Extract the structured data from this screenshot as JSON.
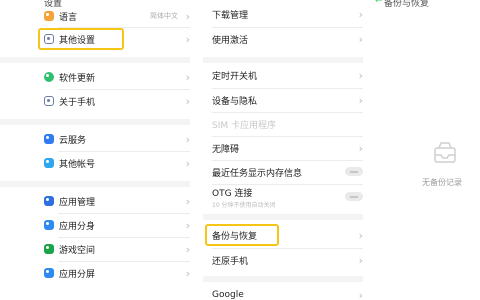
{
  "panel1": {
    "top_text": "设置",
    "items": [
      {
        "label": "语言",
        "value": "简体中文",
        "icon": "language-icon",
        "color": "#f2a33a"
      },
      {
        "label": "其他设置",
        "icon": "other-settings-icon",
        "color": "#6b7ca8"
      },
      {
        "label": "软件更新",
        "icon": "software-update-icon",
        "color": "#2fbf71"
      },
      {
        "label": "关于手机",
        "icon": "about-phone-icon",
        "color": "#6b7ca8"
      },
      {
        "label": "云服务",
        "icon": "cloud-service-icon",
        "color": "#2f7bf0"
      },
      {
        "label": "其他帐号",
        "icon": "other-accounts-icon",
        "color": "#2fa6f0"
      },
      {
        "label": "应用管理",
        "icon": "app-management-icon",
        "color": "#2f6fe0"
      },
      {
        "label": "应用分身",
        "icon": "app-clone-icon",
        "color": "#2f8af0"
      },
      {
        "label": "游戏空间",
        "icon": "game-space-icon",
        "color": "#1aa44a"
      },
      {
        "label": "应用分屏",
        "icon": "split-screen-icon",
        "color": "#2f8af0"
      }
    ]
  },
  "panel2": {
    "top_text": "下载管理",
    "items": [
      {
        "label": "下载管理"
      },
      {
        "label": "使用激活"
      },
      {
        "label": "定时开关机"
      },
      {
        "label": "设备与隐私"
      },
      {
        "label": "SIM 卡应用程序"
      },
      {
        "label": "无障碍"
      },
      {
        "label": "最近任务显示内存信息"
      },
      {
        "label": "OTG 连接"
      },
      {
        "label": "备份与恢复"
      },
      {
        "label": "还原手机"
      },
      {
        "label": "Google"
      }
    ],
    "otg_note": "10 分钟不使用自动关闭"
  },
  "panel3": {
    "back": "←",
    "title": "备份与恢复",
    "empty_text": "无备份记录"
  },
  "colors": {
    "highlight": "#f5c518",
    "accent_green": "#2fbf71"
  }
}
